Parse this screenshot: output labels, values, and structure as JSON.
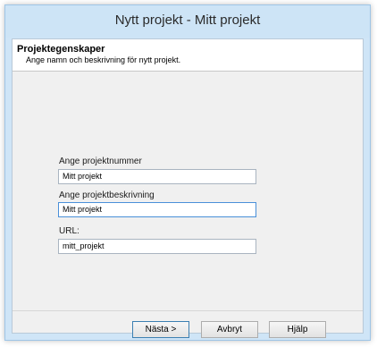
{
  "window": {
    "title": "Nytt projekt - Mitt projekt"
  },
  "header": {
    "title": "Projektegenskaper",
    "subtitle": "Ange namn och beskrivning för nytt projekt."
  },
  "form": {
    "project_number": {
      "label": "Ange projektnummer",
      "value": "Mitt projekt"
    },
    "project_description": {
      "label": "Ange projektbeskrivning",
      "value": "Mitt projekt"
    },
    "url": {
      "label": "URL:",
      "value": "mitt_projekt"
    }
  },
  "buttons": {
    "next": "Nästa >",
    "cancel": "Avbryt",
    "help": "Hjälp"
  }
}
